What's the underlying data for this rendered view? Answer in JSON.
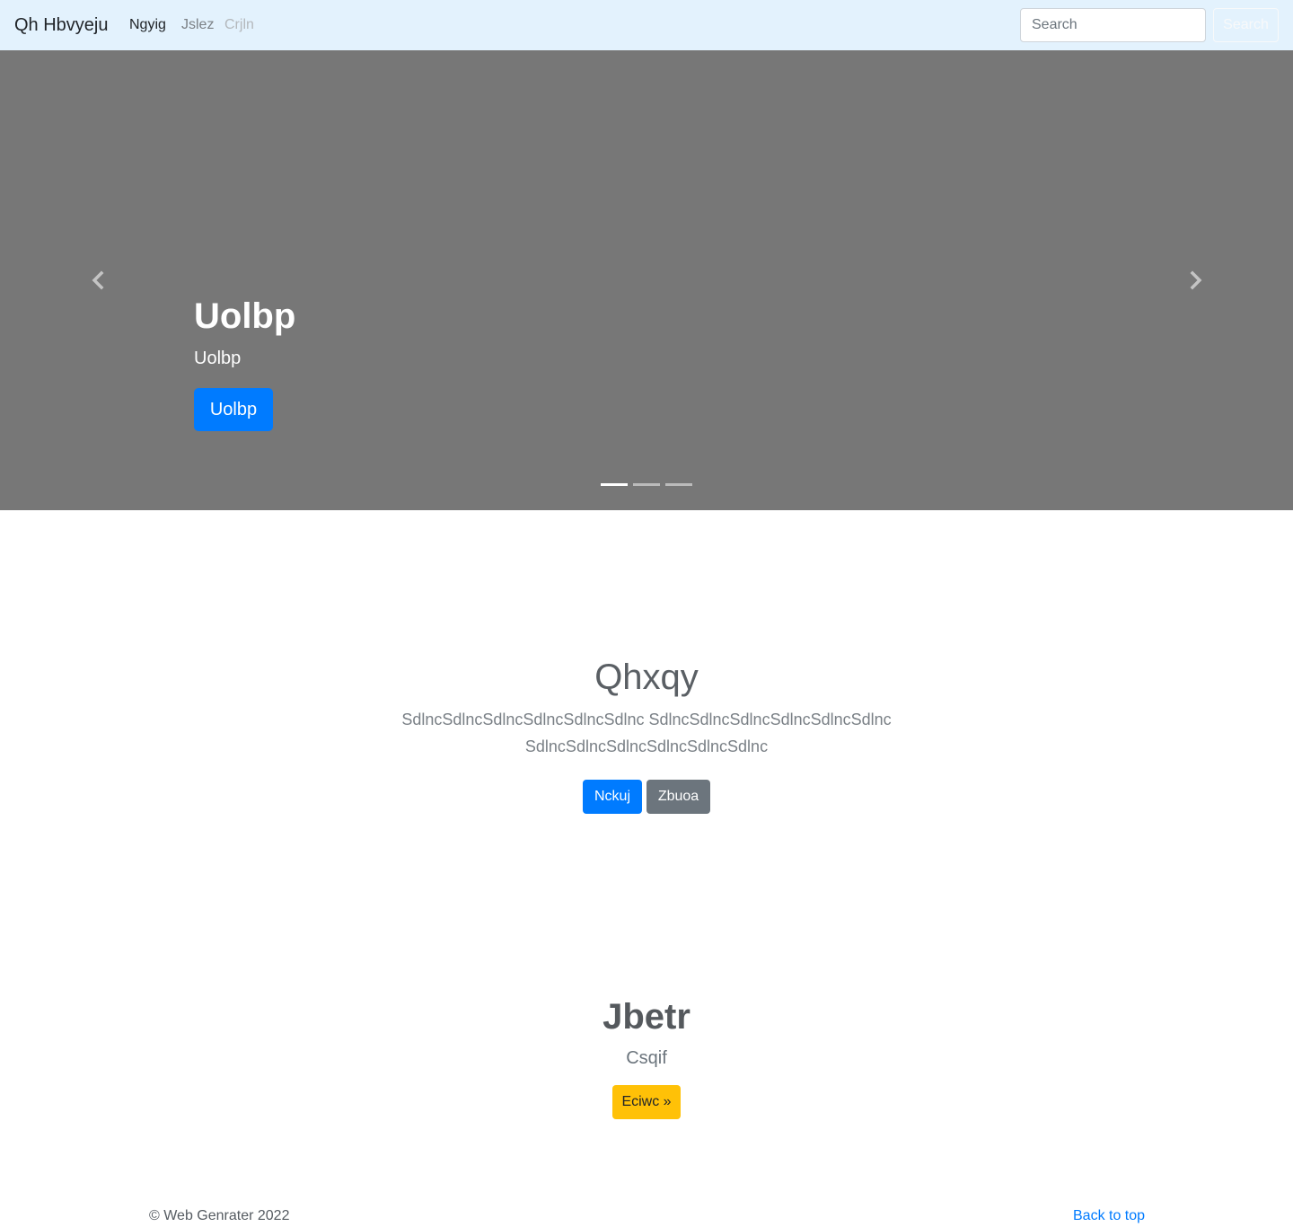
{
  "navbar": {
    "brand": "Qh Hbvyeju",
    "links": [
      {
        "label": "Ngyig",
        "state": "active"
      },
      {
        "label": "Jslez",
        "state": "normal"
      },
      {
        "label": "Crjln",
        "state": "disabled"
      }
    ],
    "search_placeholder": "Search",
    "search_button": "Search"
  },
  "carousel": {
    "background_color": "#777777",
    "slide_title": "Uolbp",
    "slide_text": "Uolbp",
    "slide_button": "Uolbp",
    "slide_count": 3,
    "active_slide": 0,
    "prev_icon": "chevron-left-icon",
    "next_icon": "chevron-right-icon"
  },
  "section1": {
    "heading": "Qhxqy",
    "lead": "SdlncSdlncSdlncSdlncSdlncSdlnc SdlncSdlncSdlncSdlncSdlncSdlnc SdlncSdlncSdlncSdlncSdlncSdlnc",
    "primary_button": "Nckuj",
    "secondary_button": "Zbuoa"
  },
  "section2": {
    "heading": "Jbetr",
    "text": "Csqif",
    "button": "Eciwc »"
  },
  "footer": {
    "copyright": "© Web Genrater 2022",
    "back_to_top": "Back to top"
  },
  "colors": {
    "navbar_bg": "#e3f2fd",
    "primary": "#007bff",
    "secondary": "#6c757d",
    "warning": "#ffc107"
  }
}
